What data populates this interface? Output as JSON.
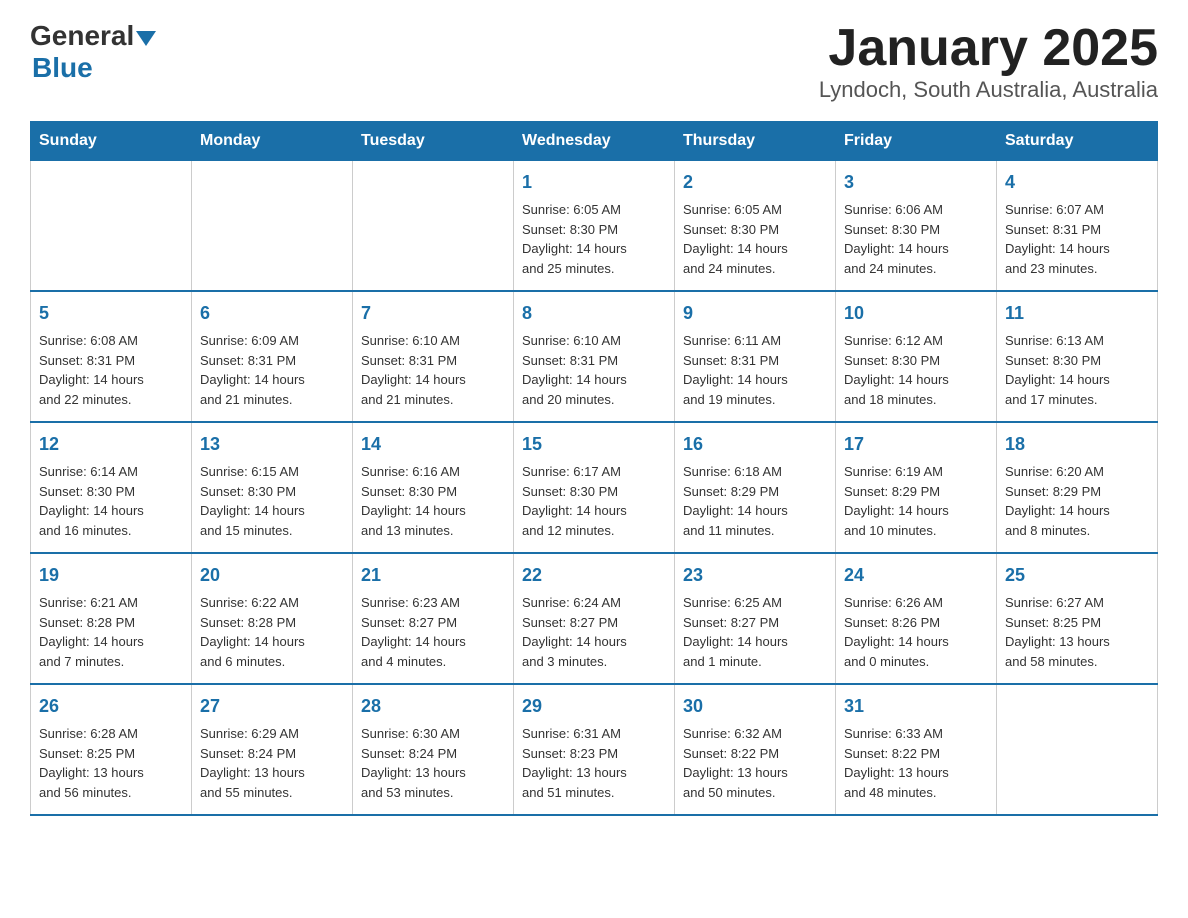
{
  "header": {
    "logo_general": "General",
    "logo_blue": "Blue",
    "title": "January 2025",
    "subtitle": "Lyndoch, South Australia, Australia"
  },
  "days_of_week": [
    "Sunday",
    "Monday",
    "Tuesday",
    "Wednesday",
    "Thursday",
    "Friday",
    "Saturday"
  ],
  "weeks": [
    [
      {
        "day": "",
        "info": ""
      },
      {
        "day": "",
        "info": ""
      },
      {
        "day": "",
        "info": ""
      },
      {
        "day": "1",
        "info": "Sunrise: 6:05 AM\nSunset: 8:30 PM\nDaylight: 14 hours\nand 25 minutes."
      },
      {
        "day": "2",
        "info": "Sunrise: 6:05 AM\nSunset: 8:30 PM\nDaylight: 14 hours\nand 24 minutes."
      },
      {
        "day": "3",
        "info": "Sunrise: 6:06 AM\nSunset: 8:30 PM\nDaylight: 14 hours\nand 24 minutes."
      },
      {
        "day": "4",
        "info": "Sunrise: 6:07 AM\nSunset: 8:31 PM\nDaylight: 14 hours\nand 23 minutes."
      }
    ],
    [
      {
        "day": "5",
        "info": "Sunrise: 6:08 AM\nSunset: 8:31 PM\nDaylight: 14 hours\nand 22 minutes."
      },
      {
        "day": "6",
        "info": "Sunrise: 6:09 AM\nSunset: 8:31 PM\nDaylight: 14 hours\nand 21 minutes."
      },
      {
        "day": "7",
        "info": "Sunrise: 6:10 AM\nSunset: 8:31 PM\nDaylight: 14 hours\nand 21 minutes."
      },
      {
        "day": "8",
        "info": "Sunrise: 6:10 AM\nSunset: 8:31 PM\nDaylight: 14 hours\nand 20 minutes."
      },
      {
        "day": "9",
        "info": "Sunrise: 6:11 AM\nSunset: 8:31 PM\nDaylight: 14 hours\nand 19 minutes."
      },
      {
        "day": "10",
        "info": "Sunrise: 6:12 AM\nSunset: 8:30 PM\nDaylight: 14 hours\nand 18 minutes."
      },
      {
        "day": "11",
        "info": "Sunrise: 6:13 AM\nSunset: 8:30 PM\nDaylight: 14 hours\nand 17 minutes."
      }
    ],
    [
      {
        "day": "12",
        "info": "Sunrise: 6:14 AM\nSunset: 8:30 PM\nDaylight: 14 hours\nand 16 minutes."
      },
      {
        "day": "13",
        "info": "Sunrise: 6:15 AM\nSunset: 8:30 PM\nDaylight: 14 hours\nand 15 minutes."
      },
      {
        "day": "14",
        "info": "Sunrise: 6:16 AM\nSunset: 8:30 PM\nDaylight: 14 hours\nand 13 minutes."
      },
      {
        "day": "15",
        "info": "Sunrise: 6:17 AM\nSunset: 8:30 PM\nDaylight: 14 hours\nand 12 minutes."
      },
      {
        "day": "16",
        "info": "Sunrise: 6:18 AM\nSunset: 8:29 PM\nDaylight: 14 hours\nand 11 minutes."
      },
      {
        "day": "17",
        "info": "Sunrise: 6:19 AM\nSunset: 8:29 PM\nDaylight: 14 hours\nand 10 minutes."
      },
      {
        "day": "18",
        "info": "Sunrise: 6:20 AM\nSunset: 8:29 PM\nDaylight: 14 hours\nand 8 minutes."
      }
    ],
    [
      {
        "day": "19",
        "info": "Sunrise: 6:21 AM\nSunset: 8:28 PM\nDaylight: 14 hours\nand 7 minutes."
      },
      {
        "day": "20",
        "info": "Sunrise: 6:22 AM\nSunset: 8:28 PM\nDaylight: 14 hours\nand 6 minutes."
      },
      {
        "day": "21",
        "info": "Sunrise: 6:23 AM\nSunset: 8:27 PM\nDaylight: 14 hours\nand 4 minutes."
      },
      {
        "day": "22",
        "info": "Sunrise: 6:24 AM\nSunset: 8:27 PM\nDaylight: 14 hours\nand 3 minutes."
      },
      {
        "day": "23",
        "info": "Sunrise: 6:25 AM\nSunset: 8:27 PM\nDaylight: 14 hours\nand 1 minute."
      },
      {
        "day": "24",
        "info": "Sunrise: 6:26 AM\nSunset: 8:26 PM\nDaylight: 14 hours\nand 0 minutes."
      },
      {
        "day": "25",
        "info": "Sunrise: 6:27 AM\nSunset: 8:25 PM\nDaylight: 13 hours\nand 58 minutes."
      }
    ],
    [
      {
        "day": "26",
        "info": "Sunrise: 6:28 AM\nSunset: 8:25 PM\nDaylight: 13 hours\nand 56 minutes."
      },
      {
        "day": "27",
        "info": "Sunrise: 6:29 AM\nSunset: 8:24 PM\nDaylight: 13 hours\nand 55 minutes."
      },
      {
        "day": "28",
        "info": "Sunrise: 6:30 AM\nSunset: 8:24 PM\nDaylight: 13 hours\nand 53 minutes."
      },
      {
        "day": "29",
        "info": "Sunrise: 6:31 AM\nSunset: 8:23 PM\nDaylight: 13 hours\nand 51 minutes."
      },
      {
        "day": "30",
        "info": "Sunrise: 6:32 AM\nSunset: 8:22 PM\nDaylight: 13 hours\nand 50 minutes."
      },
      {
        "day": "31",
        "info": "Sunrise: 6:33 AM\nSunset: 8:22 PM\nDaylight: 13 hours\nand 48 minutes."
      },
      {
        "day": "",
        "info": ""
      }
    ]
  ]
}
